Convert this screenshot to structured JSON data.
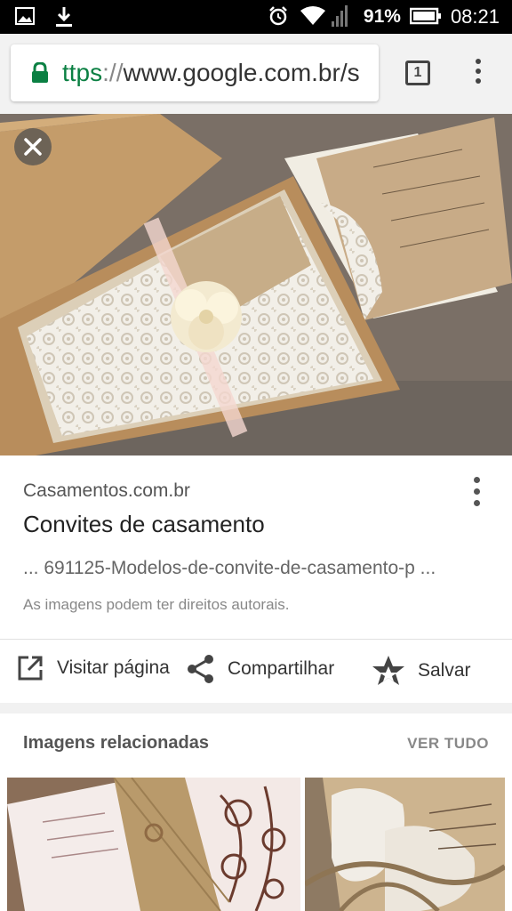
{
  "status_bar": {
    "battery": "91%",
    "time": "08:21",
    "icons": [
      "image-icon",
      "download-icon",
      "alarm-icon",
      "wifi-icon",
      "signal-icon",
      "battery-icon"
    ]
  },
  "browser": {
    "url_scheme": "ttps",
    "url_separator": "://",
    "url_host": "www.google.com.br/s",
    "tab_count": "1"
  },
  "result": {
    "source": "Casamentos.com.br",
    "title": "Convites de casamento",
    "snippet": "... 691125-Modelos-de-convite-de-casamento-p ...",
    "rights_notice": "As imagens podem ter direitos autorais."
  },
  "actions": {
    "visit_label": "Visitar página",
    "share_label": "Compartilhar",
    "save_label": "Salvar"
  },
  "related": {
    "title": "Imagens relacionadas",
    "see_all_label": "VER TUDO"
  },
  "colors": {
    "secure_green": "#0b8043",
    "photo_kraft": "#c9a878",
    "lace_white": "#f4f1ec"
  }
}
